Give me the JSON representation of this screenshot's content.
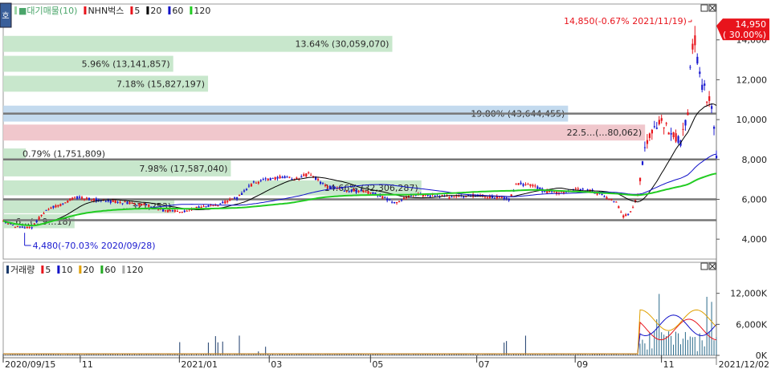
{
  "chart_data": {
    "type": "candlestick",
    "price_panel": {
      "legend": [
        {
          "name": "■대기매물(10)",
          "color": "#9fd6a7"
        },
        {
          "name": "NHN벅스",
          "color": "#e8141c"
        },
        {
          "name": "5",
          "color": "#e8141c"
        },
        {
          "name": "20",
          "color": "#000000"
        },
        {
          "name": "60",
          "color": "#1010c8"
        },
        {
          "name": "120",
          "color": "#22cc22"
        }
      ],
      "button": "호",
      "y_ticks": [
        4000,
        6000,
        8000,
        10000,
        12000,
        14000
      ],
      "y_tick_labels": [
        "4,000",
        "6,000",
        "8,000",
        "10,000",
        "12,000",
        "14,000"
      ],
      "ylim": [
        3000,
        15800
      ],
      "current_price": {
        "value": 14950,
        "label": "14,950",
        "change": "( 30.00%)"
      },
      "high_annotation": {
        "value": 14850,
        "text": "14,850(-0.67% 2021/11/19)"
      },
      "low_annotation": {
        "value": 4480,
        "text": "4,480(-70.03% 2020/09/28)"
      },
      "horizontal_lines": [
        10300,
        8000,
        6000,
        4950
      ],
      "volume_profile": [
        {
          "low": 13400,
          "high": 14200,
          "pct": 13.64,
          "label": "13.64% (30,059,070)",
          "color": "#c2e4c6"
        },
        {
          "low": 12400,
          "high": 13200,
          "pct": 5.96,
          "label": "5.96% (13,141,857)",
          "color": "#c2e4c6"
        },
        {
          "low": 11400,
          "high": 12200,
          "pct": 7.18,
          "label": "7.18% (15,827,197)",
          "color": "#c2e4c6"
        },
        {
          "low": 9900,
          "high": 10700,
          "pct": 19.8,
          "label": "19.80% (43,644,455)",
          "color": "#bcd6ec"
        },
        {
          "low": 8950,
          "high": 9750,
          "pct": 22.5,
          "label": "22.5…(…80,062)",
          "color": "#eec1c7"
        },
        {
          "low": 8050,
          "high": 8550,
          "pct": 0.79,
          "label": "0.79% (1,751,809)",
          "color": "#c2e4c6"
        },
        {
          "low": 7150,
          "high": 7950,
          "pct": 7.98,
          "label": "7.98% (17,587,040)",
          "color": "#c2e4c6"
        },
        {
          "low": 6200,
          "high": 6950,
          "pct": 14.66,
          "label": "14.66% (32,306,287)",
          "color": "#c2e4c6"
        },
        {
          "low": 5300,
          "high": 6000,
          "pct": 6.0,
          "label": "…321,253)",
          "color": "#c2e4c6"
        },
        {
          "low": 4550,
          "high": 5250,
          "pct": 2.5,
          "label": "…6…(…9…18)",
          "color": "#c2e4c6"
        }
      ]
    },
    "volume_panel": {
      "legend": [
        {
          "name": "거래량",
          "color": "#1a3a6a"
        },
        {
          "name": "5",
          "color": "#e8141c"
        },
        {
          "name": "10",
          "color": "#1010c8"
        },
        {
          "name": "20",
          "color": "#e0a000"
        },
        {
          "name": "60",
          "color": "#22aa22"
        },
        {
          "name": "120",
          "color": "#aaaaaa"
        }
      ],
      "y_ticks": [
        0,
        6000,
        12000
      ],
      "y_tick_labels": [
        "0K",
        "6,000K",
        "12,000K"
      ],
      "ylim": [
        0,
        18000
      ]
    },
    "x_axis": {
      "labels": [
        "2020/09/15",
        "11",
        "2021/01",
        "03",
        "05",
        "07",
        "09",
        "11",
        "2021/12/02"
      ],
      "positions": [
        0,
        0.108,
        0.247,
        0.373,
        0.515,
        0.664,
        0.802,
        0.923,
        1.0
      ]
    },
    "price_path": [
      [
        0,
        4900
      ],
      [
        0.02,
        4600
      ],
      [
        0.04,
        4600
      ],
      [
        0.06,
        5500
      ],
      [
        0.08,
        5700
      ],
      [
        0.1,
        6100
      ],
      [
        0.12,
        6000
      ],
      [
        0.15,
        5900
      ],
      [
        0.18,
        5800
      ],
      [
        0.2,
        5700
      ],
      [
        0.23,
        5400
      ],
      [
        0.255,
        5400
      ],
      [
        0.27,
        5600
      ],
      [
        0.3,
        5700
      ],
      [
        0.33,
        6100
      ],
      [
        0.35,
        6800
      ],
      [
        0.37,
        7000
      ],
      [
        0.39,
        7100
      ],
      [
        0.41,
        7000
      ],
      [
        0.43,
        7300
      ],
      [
        0.45,
        6700
      ],
      [
        0.47,
        6500
      ],
      [
        0.5,
        6400
      ],
      [
        0.52,
        6300
      ],
      [
        0.55,
        5800
      ],
      [
        0.57,
        6200
      ],
      [
        0.6,
        6200
      ],
      [
        0.63,
        6100
      ],
      [
        0.66,
        6200
      ],
      [
        0.69,
        6100
      ],
      [
        0.71,
        6000
      ],
      [
        0.72,
        6800
      ],
      [
        0.74,
        6700
      ],
      [
        0.76,
        6400
      ],
      [
        0.78,
        6300
      ],
      [
        0.8,
        6500
      ],
      [
        0.82,
        6500
      ],
      [
        0.84,
        6200
      ],
      [
        0.86,
        5800
      ],
      [
        0.87,
        5100
      ],
      [
        0.88,
        5400
      ],
      [
        0.89,
        6200
      ],
      [
        0.9,
        8700
      ],
      [
        0.91,
        9400
      ],
      [
        0.92,
        10000
      ],
      [
        0.93,
        9600
      ],
      [
        0.94,
        9200
      ],
      [
        0.95,
        8800
      ],
      [
        0.96,
        10500
      ],
      [
        0.965,
        13300
      ],
      [
        0.97,
        13900
      ],
      [
        0.975,
        12500
      ],
      [
        0.98,
        11800
      ],
      [
        0.985,
        11300
      ],
      [
        0.99,
        11000
      ],
      [
        0.995,
        10200
      ],
      [
        1.0,
        8300
      ]
    ]
  }
}
